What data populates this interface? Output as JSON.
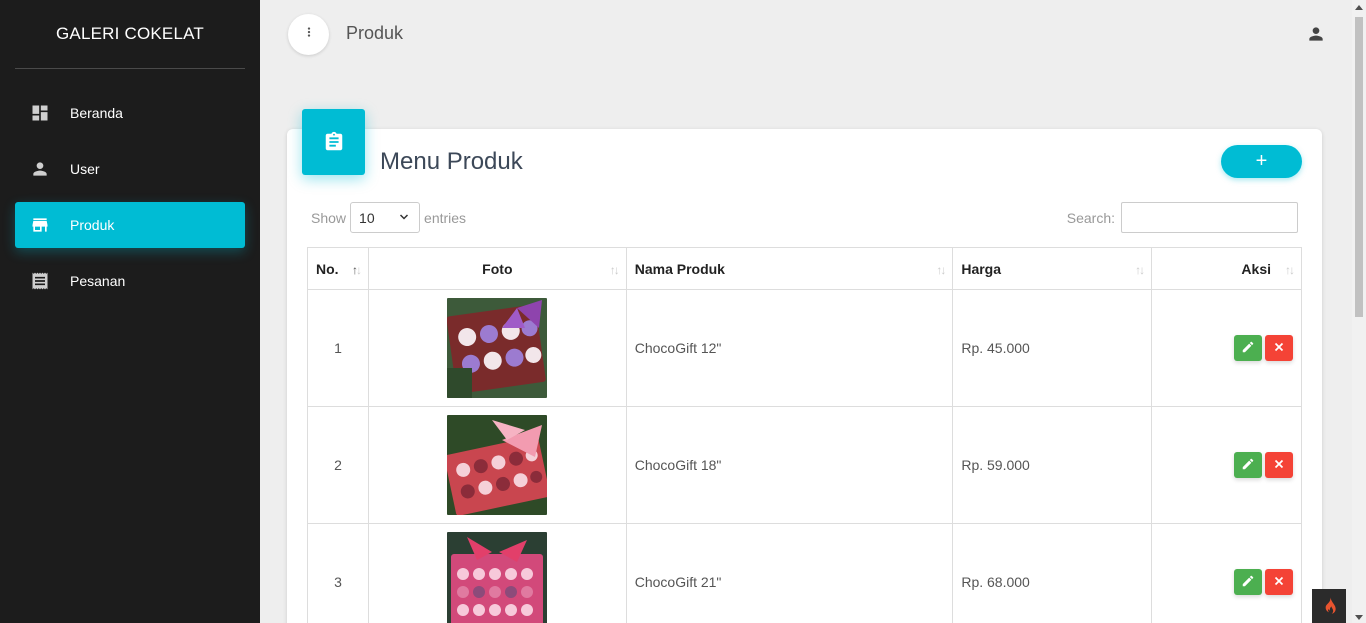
{
  "sidebar": {
    "brand": "GALERI COKELAT",
    "items": [
      {
        "label": "Beranda",
        "icon": "dashboard-icon"
      },
      {
        "label": "User",
        "icon": "person-icon"
      },
      {
        "label": "Produk",
        "icon": "store-icon",
        "active": true
      },
      {
        "label": "Pesanan",
        "icon": "receipt-icon"
      }
    ]
  },
  "topbar": {
    "title": "Produk",
    "menu_icon": "more-vert-icon",
    "user_icon": "person-icon"
  },
  "card": {
    "title": "Menu Produk",
    "icon": "assignment-icon",
    "add_label": "+"
  },
  "controls": {
    "show_label": "Show",
    "page_size": "10",
    "entries_label": "entries",
    "search_label": "Search:",
    "search_value": ""
  },
  "table": {
    "headers": [
      "No.",
      "Foto",
      "Nama Produk",
      "Harga",
      "Aksi"
    ],
    "rows": [
      {
        "no": "1",
        "name": "ChocoGift 12\"",
        "price": "Rp. 45.000"
      },
      {
        "no": "2",
        "name": "ChocoGift 18\"",
        "price": "Rp. 59.000"
      },
      {
        "no": "3",
        "name": "ChocoGift 21\"",
        "price": "Rp. 68.000"
      }
    ]
  },
  "colors": {
    "accent": "#00bcd4",
    "sidebar_bg": "#1c1c1c",
    "edit": "#4caf50",
    "delete": "#f44336"
  }
}
